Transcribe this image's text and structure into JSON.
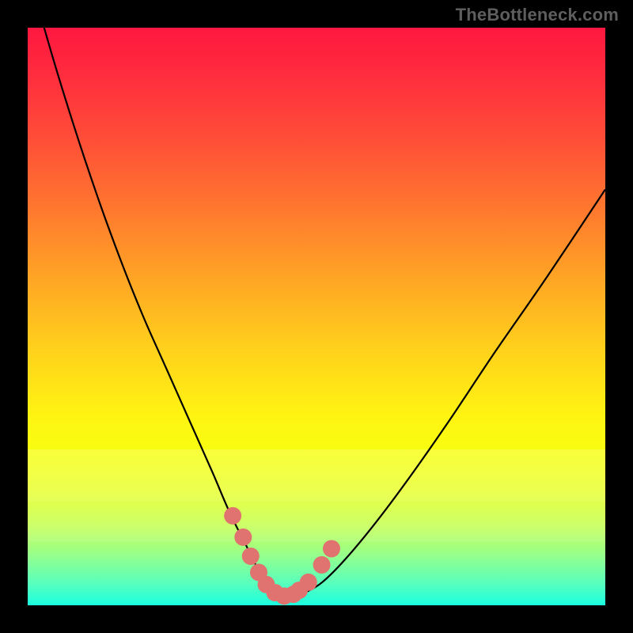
{
  "watermark": "TheBottleneck.com",
  "chart_data": {
    "type": "line",
    "title": "",
    "xlabel": "",
    "ylabel": "",
    "xlim": [
      0,
      100
    ],
    "ylim": [
      0,
      100
    ],
    "grid": false,
    "series": [
      {
        "name": "bottleneck-curve",
        "x": [
          0,
          4,
          8,
          12,
          16,
          20,
          24,
          28,
          32,
          35,
          38,
          40,
          42,
          44,
          46,
          48,
          51,
          55,
          60,
          66,
          73,
          81,
          90,
          100
        ],
        "y": [
          110,
          96,
          83,
          71,
          60,
          50,
          41,
          32,
          23,
          16,
          10,
          6,
          3,
          1.7,
          1.5,
          2.2,
          4,
          8,
          14,
          22,
          32,
          44,
          57,
          72
        ]
      }
    ],
    "markers": {
      "name": "highlight-points",
      "color": "#e0736f",
      "points": [
        {
          "x": 35.5,
          "y": 15.5
        },
        {
          "x": 37.3,
          "y": 11.8
        },
        {
          "x": 38.6,
          "y": 8.5
        },
        {
          "x": 40.0,
          "y": 5.7
        },
        {
          "x": 41.3,
          "y": 3.6
        },
        {
          "x": 42.8,
          "y": 2.2
        },
        {
          "x": 44.4,
          "y": 1.6
        },
        {
          "x": 46.0,
          "y": 1.9
        },
        {
          "x": 47.0,
          "y": 2.6
        },
        {
          "x": 48.6,
          "y": 4.0
        },
        {
          "x": 50.9,
          "y": 7.0
        },
        {
          "x": 52.6,
          "y": 9.8
        }
      ]
    },
    "bands": [
      {
        "name": "pale-band-1",
        "top_pct": 73,
        "height_pct": 9,
        "opacity": 0.18
      },
      {
        "name": "pale-band-2",
        "top_pct": 82,
        "height_pct": 7,
        "opacity": 0.1
      }
    ]
  }
}
